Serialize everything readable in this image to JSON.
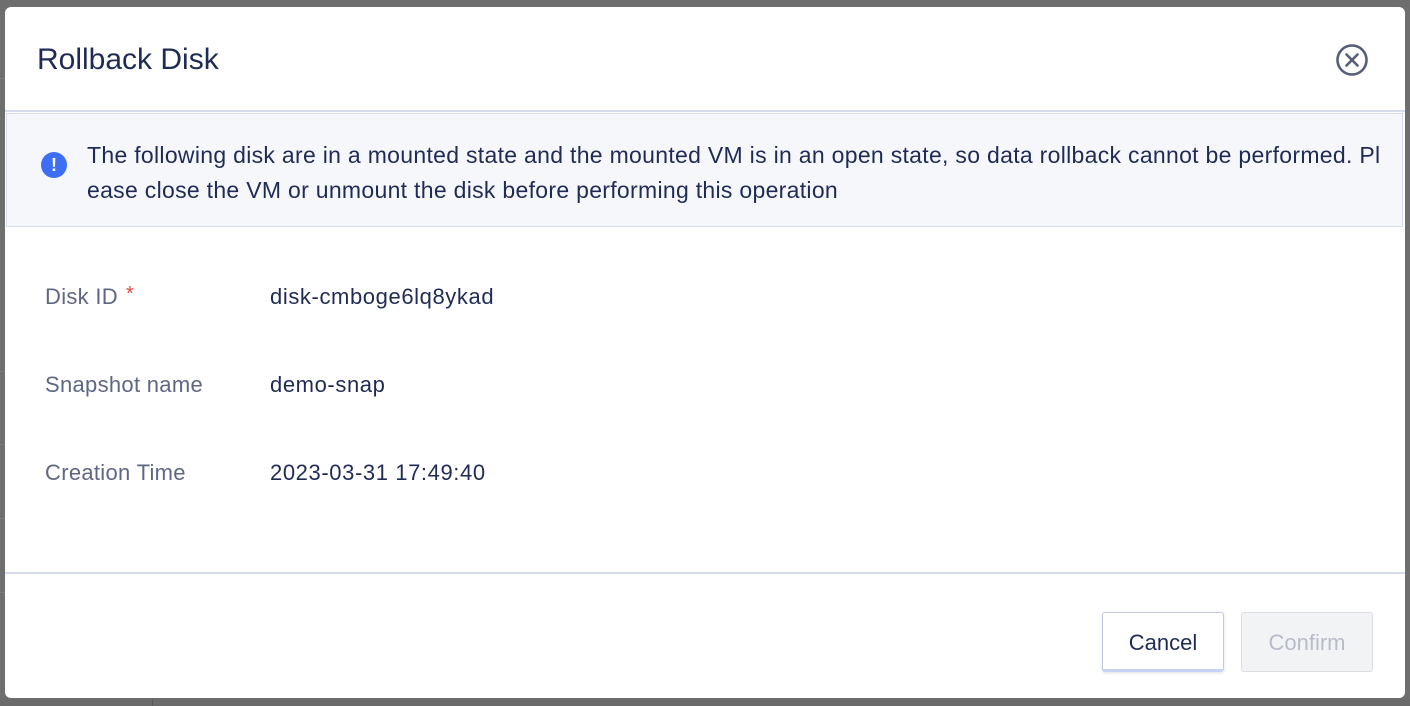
{
  "modal": {
    "title": "Rollback Disk",
    "alert_text": "The following disk are in a mounted state and the mounted VM is in an open state, so data rollback cannot be performed. Please close the VM or unmount the disk before performing this operation",
    "fields": [
      {
        "label": "Disk ID",
        "required": true,
        "value": "disk-cmboge6lq8ykad"
      },
      {
        "label": "Snapshot name",
        "required": false,
        "value": "demo-snap"
      },
      {
        "label": "Creation Time",
        "required": false,
        "value": "2023-03-31 17:49:40"
      }
    ],
    "required_marker": "*",
    "cancel_label": "Cancel",
    "confirm_label": "Confirm",
    "confirm_disabled": true
  },
  "icons": {
    "close": "close-circle-icon",
    "alert": "info-exclamation-icon"
  },
  "colors": {
    "primary_text": "#1f2b55",
    "label_text": "#5e6784",
    "alert_bg": "#f6f7fb",
    "alert_icon": "#3d6ef5",
    "required": "#e5483d",
    "border": "#d7dced"
  }
}
